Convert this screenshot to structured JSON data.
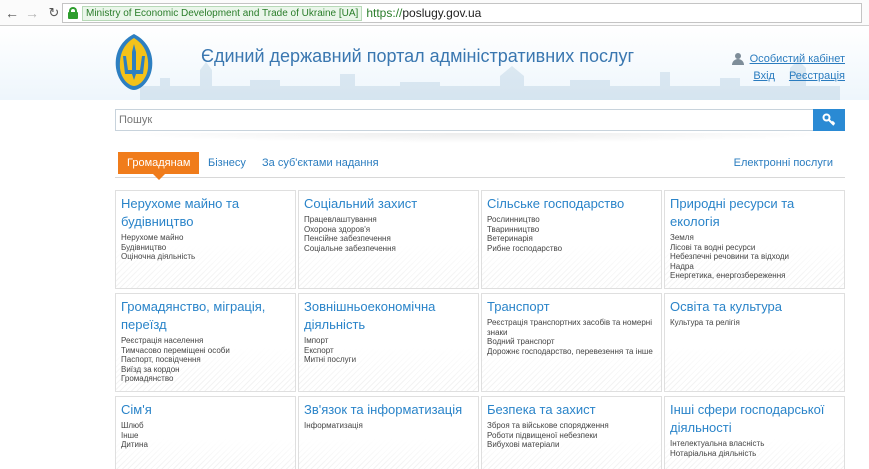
{
  "browser": {
    "cert_label": "Ministry of Economic Development and Trade of Ukraine [UA]",
    "url_scheme": "https://",
    "url_host": "poslugy.gov.ua"
  },
  "header": {
    "title": "Єдиний державний портал адміністративних послуг",
    "cabinet_link": "Особистий кабінет",
    "login_link": "Вхід",
    "register_link": "Реєстрація"
  },
  "search": {
    "placeholder": "Пошук"
  },
  "tabs": {
    "citizens": "Громадянам",
    "business": "Бізнесу",
    "by_provider": "За суб'єктами надання",
    "electronic": "Електронні послуги"
  },
  "categories": [
    {
      "title": "Нерухоме майно та будівництво",
      "items": [
        "Нерухоме майно",
        "Будівництво",
        "Оціночна діяльність"
      ]
    },
    {
      "title": "Соціальний захист",
      "items": [
        "Працевлаштування",
        "Охорона здоров'я",
        "Пенсійне забезпечення",
        "Соціальне забезпечення"
      ]
    },
    {
      "title": "Сільське господарство",
      "items": [
        "Рослинництво",
        "Тваринництво",
        "Ветеринарія",
        "Рибне господарство"
      ]
    },
    {
      "title": "Природні ресурси та екологія",
      "items": [
        "Земля",
        "Лісові та водні ресурси",
        "Небезпечні речовини та відходи",
        "Надра",
        "Енергетика, енергозбереження"
      ]
    },
    {
      "title": "Громадянство, міграція, переїзд",
      "items": [
        "Реєстрація населення",
        "Тимчасово переміщені особи",
        "Паспорт, посвідчення",
        "Виїзд за кордон",
        "Громадянство"
      ]
    },
    {
      "title": "Зовнішньоекономічна діяльність",
      "items": [
        "Імпорт",
        "Експорт",
        "Митні послуги"
      ]
    },
    {
      "title": "Транспорт",
      "items": [
        "Реєстрація транспортних засобів та номерні знаки",
        "Водний транспорт",
        "Дорожнє господарство, перевезення та інше"
      ]
    },
    {
      "title": "Освіта та культура",
      "items": [
        "Культура та релігія"
      ]
    },
    {
      "title": "Сім'я",
      "items": [
        "Шлюб",
        "Інше",
        "Дитина"
      ]
    },
    {
      "title": "Зв'язок та інформатизація",
      "items": [
        "Інформатизація"
      ]
    },
    {
      "title": "Безпека та захист",
      "items": [
        "Зброя та військове спорядження",
        "Роботи підвищеної небезпеки",
        "Вибухові матеріали"
      ]
    },
    {
      "title": "Інші сфери господарської діяльності",
      "items": [
        "Інтелектуальна власність",
        "Нотаріальна діяльність"
      ]
    }
  ],
  "colors": {
    "accent_orange": "#f07c1b",
    "link_blue": "#2a84c9",
    "search_button": "#2a8ad4"
  }
}
